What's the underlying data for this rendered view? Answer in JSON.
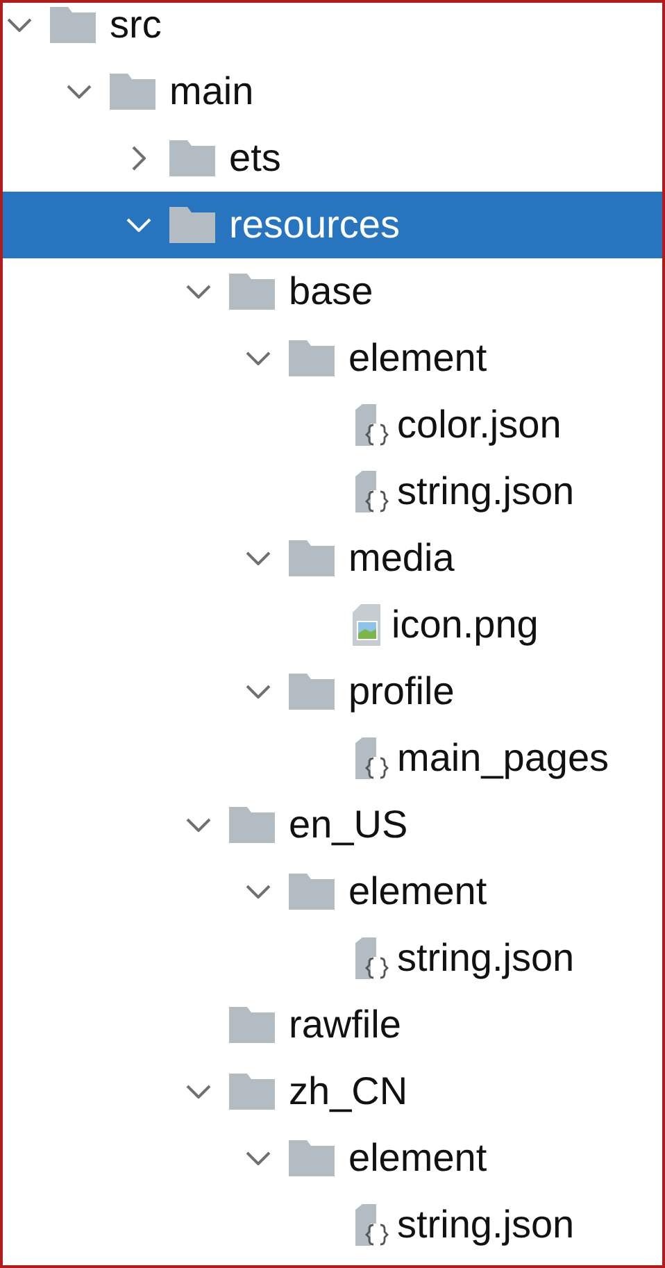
{
  "tree": [
    {
      "label": "src",
      "kind": "folder",
      "expanded": true,
      "selected": false,
      "children": [
        {
          "label": "main",
          "kind": "folder",
          "expanded": true,
          "selected": false,
          "children": [
            {
              "label": "ets",
              "kind": "folder",
              "expanded": false,
              "selected": false
            },
            {
              "label": "resources",
              "kind": "folder",
              "expanded": true,
              "selected": true,
              "children": [
                {
                  "label": "base",
                  "kind": "folder",
                  "expanded": true,
                  "selected": false,
                  "children": [
                    {
                      "label": "element",
                      "kind": "folder",
                      "expanded": true,
                      "selected": false,
                      "children": [
                        {
                          "label": "color.json",
                          "kind": "json",
                          "selected": false
                        },
                        {
                          "label": "string.json",
                          "kind": "json",
                          "selected": false
                        }
                      ]
                    },
                    {
                      "label": "media",
                      "kind": "folder",
                      "expanded": true,
                      "selected": false,
                      "children": [
                        {
                          "label": "icon.png",
                          "kind": "image",
                          "selected": false
                        }
                      ]
                    },
                    {
                      "label": "profile",
                      "kind": "folder",
                      "expanded": true,
                      "selected": false,
                      "children": [
                        {
                          "label": "main_pages",
                          "kind": "json",
                          "selected": false
                        }
                      ]
                    }
                  ]
                },
                {
                  "label": "en_US",
                  "kind": "folder",
                  "expanded": true,
                  "selected": false,
                  "children": [
                    {
                      "label": "element",
                      "kind": "folder",
                      "expanded": true,
                      "selected": false,
                      "children": [
                        {
                          "label": "string.json",
                          "kind": "json",
                          "selected": false
                        }
                      ]
                    }
                  ]
                },
                {
                  "label": "rawfile",
                  "kind": "folder",
                  "selected": false
                },
                {
                  "label": "zh_CN",
                  "kind": "folder",
                  "expanded": true,
                  "selected": false,
                  "children": [
                    {
                      "label": "element",
                      "kind": "folder",
                      "expanded": true,
                      "selected": false,
                      "children": [
                        {
                          "label": "string.json",
                          "kind": "json",
                          "selected": false
                        }
                      ]
                    }
                  ]
                }
              ]
            }
          ]
        }
      ]
    }
  ]
}
